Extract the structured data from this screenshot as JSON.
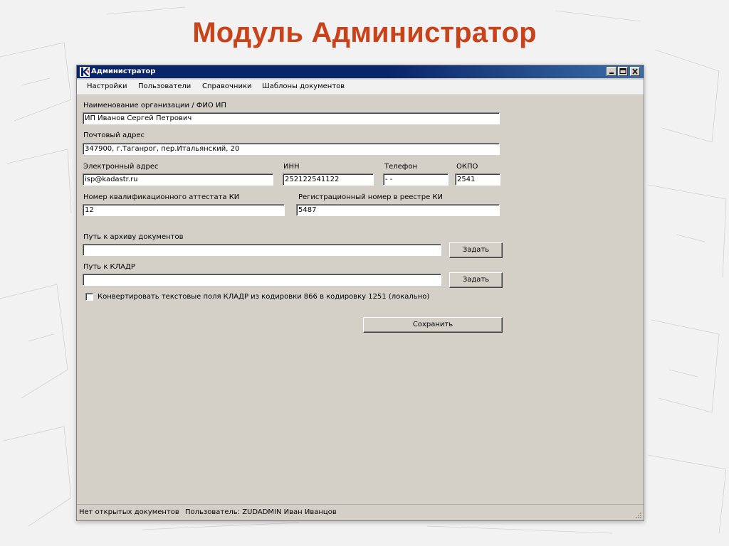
{
  "slide": {
    "title": "Модуль Администратор"
  },
  "window": {
    "title": "Администратор",
    "icon": "k-logo-icon",
    "controls": [
      "minimize-icon",
      "maximize-icon",
      "close-icon"
    ]
  },
  "menu": {
    "items": [
      {
        "label": "Настройки"
      },
      {
        "label": "Пользователи"
      },
      {
        "label": "Справочники"
      },
      {
        "label": "Шаблоны документов"
      }
    ]
  },
  "form": {
    "org_label": "Наименование организации / ФИО ИП",
    "org_value": "ИП Иванов Сергей Петрович",
    "postal_label": "Почтовый адрес",
    "postal_value": "347900, г.Таганрог, пер.Итальянский, 20",
    "email_label": "Электронный адрес",
    "email_value": "isp@kadastr.ru",
    "inn_label": "ИНН",
    "inn_value": "252122541122",
    "phone_label": "Телефон",
    "phone_value": "-  -",
    "okpo_label": "ОКПО",
    "okpo_value": "2541",
    "cert_label": "Номер квалификационного аттестата КИ",
    "cert_value": "12",
    "reg_label": "Регистрационный номер в реестре КИ",
    "reg_value": "5487",
    "archive_label": "Путь к архиву документов",
    "archive_value": "",
    "archive_button": "Задать",
    "kladr_label": "Путь к КЛАДР",
    "kladr_value": "",
    "kladr_button": "Задать",
    "convert_label": "Конвертировать текстовые поля КЛАДР из кодировки 866 в кодировку 1251 (локально)",
    "convert_checked": false,
    "save_button": "Сохранить"
  },
  "status": {
    "documents": "Нет открытых документов",
    "user": "Пользователь: ZUDADMIN  Иван Иванцов"
  },
  "colors": {
    "title": "#c8421a",
    "titlebar": "#0a246a",
    "window_bg": "#d4d0c8",
    "menubar_bg": "#f0f0f0"
  }
}
